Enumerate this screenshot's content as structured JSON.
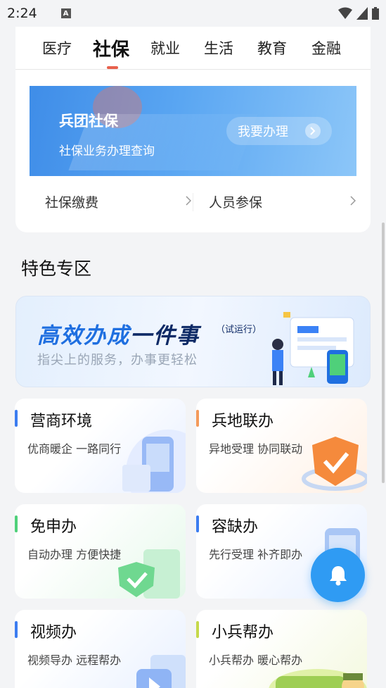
{
  "status_bar": {
    "time": "2:24",
    "a_badge": "A"
  },
  "tabs": [
    {
      "label": "医疗",
      "active": false
    },
    {
      "label": "社保",
      "active": true
    },
    {
      "label": "就业",
      "active": false
    },
    {
      "label": "生活",
      "active": false
    },
    {
      "label": "教育",
      "active": false
    },
    {
      "label": "金融",
      "active": false
    }
  ],
  "banner": {
    "title": "兵团社保",
    "subtitle": "社保业务办理查询",
    "button": "我要办理"
  },
  "quick_links": [
    "社保缴费",
    "人员参保"
  ],
  "section_title": "特色专区",
  "promo": {
    "title_part1": "高效办成",
    "title_part2": "一件事",
    "tag": "（试运行）",
    "subtitle": "指尖上的服务，办事更轻松"
  },
  "features": [
    {
      "title": "营商环境",
      "subtitle": "优商暖企 一路同行",
      "accent": "#3b7cf0"
    },
    {
      "title": "兵地联办",
      "subtitle": "异地受理 协同联动",
      "accent": "#f49a5a"
    },
    {
      "title": "免申办",
      "subtitle": "自动办理 方便快捷",
      "accent": "#4fd07a"
    },
    {
      "title": "容缺办",
      "subtitle": "先行受理 补齐即办",
      "accent": "#3b7cf0"
    },
    {
      "title": "视频办",
      "subtitle": "视频导办 远程帮办",
      "accent": "#3b7cf0"
    },
    {
      "title": "小兵帮办",
      "subtitle": "小兵帮办 暖心帮办",
      "accent": "#c6d94a"
    }
  ],
  "colors": {
    "fab": "#2f9bf3",
    "primary": "#1f6fe0"
  }
}
